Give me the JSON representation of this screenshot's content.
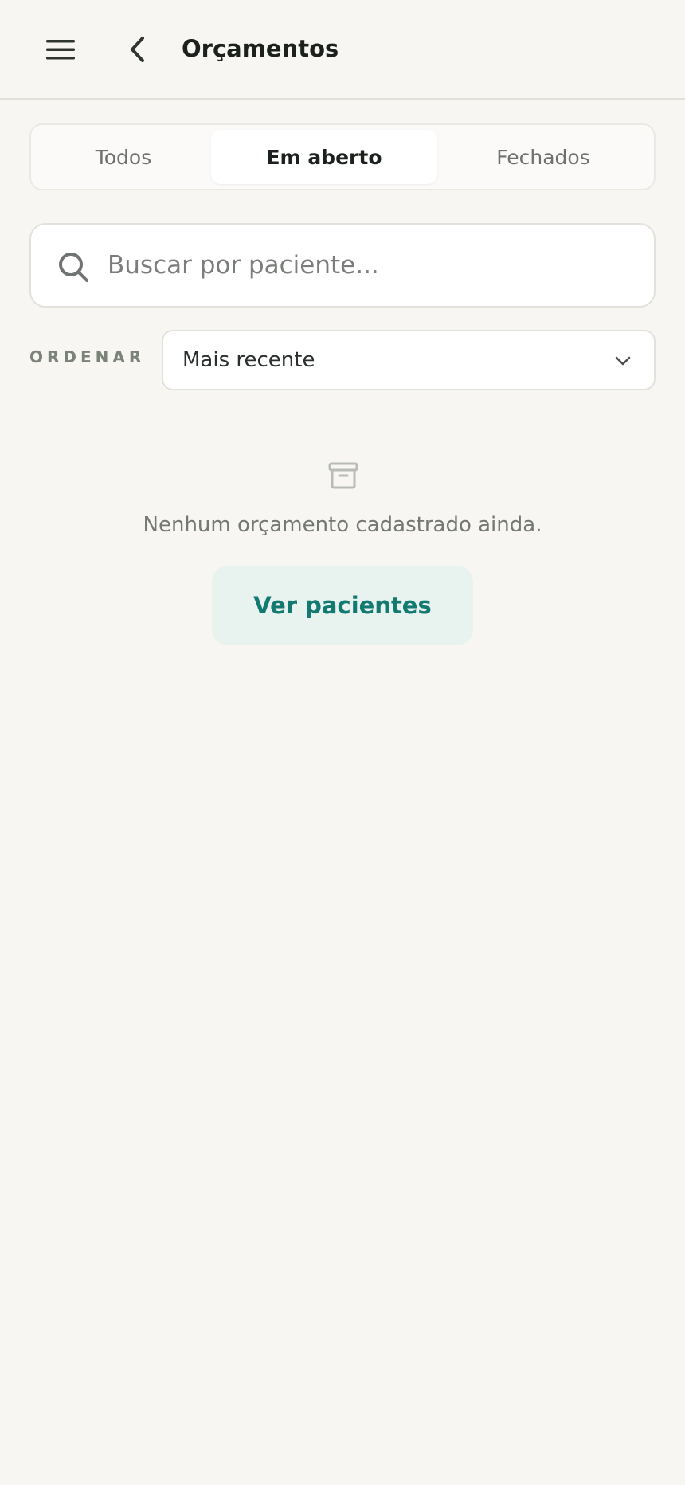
{
  "header": {
    "title": "Orçamentos",
    "menu_icon": "hamburger-menu-icon",
    "back_icon": "chevron-left-icon"
  },
  "tabs": [
    {
      "label": "Todos",
      "active": false
    },
    {
      "label": "Em aberto",
      "active": true
    },
    {
      "label": "Fechados",
      "active": false
    }
  ],
  "search": {
    "placeholder": "Buscar por paciente...",
    "value": "",
    "icon": "search-icon"
  },
  "sort": {
    "label": "ORDENAR",
    "selected": "Mais recente",
    "icon": "chevron-down-icon"
  },
  "empty_state": {
    "icon": "archive-icon",
    "message": "Nenhum orçamento cadastrado ainda.",
    "action_label": "Ver pacientes"
  },
  "colors": {
    "background": "#f7f6f3",
    "accent": "#127a70",
    "accent_soft": "#e8f3f0"
  }
}
